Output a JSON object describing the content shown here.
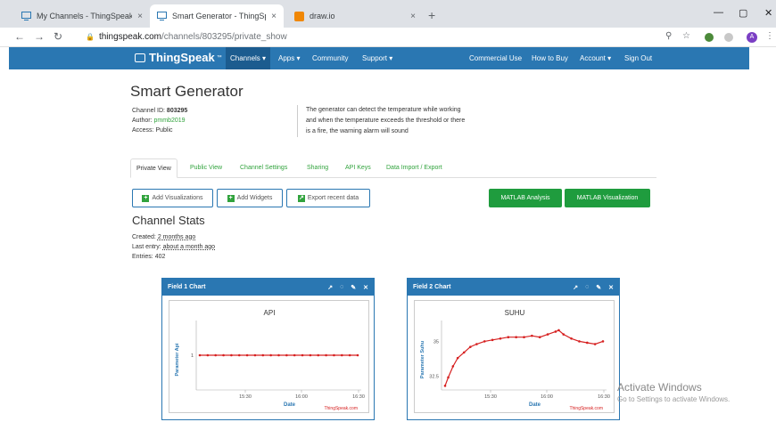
{
  "browser": {
    "tabs": [
      {
        "title": "My Channels - ThingSpeak IoT",
        "close": "×"
      },
      {
        "title": "Smart Generator - ThingSpeak Io",
        "close": "×"
      },
      {
        "title": "draw.io",
        "close": "×"
      }
    ],
    "new_tab": "+",
    "window_controls": {
      "minimize": "—",
      "maximize": "▢",
      "close": "✕"
    },
    "url_domain": "thingspeak.com",
    "url_path": "/channels/803295/private_show",
    "profile_initial": "A"
  },
  "topnav": {
    "logo": "ThingSpeak",
    "logo_tm": "™",
    "left_items": [
      "Channels ▾",
      "Apps ▾",
      "Community",
      "Support ▾"
    ],
    "right_items": [
      "Commercial Use",
      "How to Buy",
      "Account ▾",
      "Sign Out"
    ]
  },
  "channel": {
    "title": "Smart Generator",
    "id_label": "Channel ID:",
    "id_value": "803295",
    "author_label": "Author:",
    "author_value": "pmmb2019",
    "access_label": "Access:",
    "access_value": "Public",
    "description": "The generator can detect the temperature while working and when the temperature exceeds the threshold or there is a fire, the warning alarm will sound"
  },
  "page_tabs": [
    "Private View",
    "Public View",
    "Channel Settings",
    "Sharing",
    "API Keys",
    "Data Import / Export"
  ],
  "buttons": {
    "add_visualizations": "Add Visualizations",
    "add_widgets": "Add Widgets",
    "export_recent": "Export recent data",
    "matlab_analysis": "MATLAB Analysis",
    "matlab_visualization": "MATLAB Visualization"
  },
  "stats": {
    "heading": "Channel Stats",
    "created_label": "Created:",
    "created_value": "2 months ago",
    "last_entry_label": "Last entry:",
    "last_entry_value": "about a month ago",
    "entries_label": "Entries:",
    "entries_value": "402"
  },
  "field1": {
    "header": "Field 1 Chart",
    "credit": "ThingSpeak.com"
  },
  "field2": {
    "header": "Field 2 Chart",
    "credit": "ThingSpeak.com"
  },
  "chart_data": [
    {
      "type": "line",
      "title": "API",
      "xlabel": "Date",
      "ylabel": "Parameter Api",
      "xticks": [
        "15:30",
        "16:00",
        "16:30"
      ],
      "yticks": [
        "1"
      ],
      "ylim": [
        0,
        2
      ],
      "series": [
        {
          "x": [
            0.0,
            0.05,
            0.1,
            0.15,
            0.2,
            0.25,
            0.3,
            0.35,
            0.4,
            0.45,
            0.5,
            0.55,
            0.6,
            0.65,
            0.7,
            0.75,
            0.8,
            0.85,
            0.9,
            0.95,
            1.0
          ],
          "values": [
            1,
            1,
            1,
            1,
            1,
            1,
            1,
            1,
            1,
            1,
            1,
            1,
            1,
            1,
            1,
            1,
            1,
            1,
            1,
            1,
            1
          ]
        }
      ],
      "color": "#d62020"
    },
    {
      "type": "line",
      "title": "SUHU",
      "xlabel": "Date",
      "ylabel": "Parameter Suhu",
      "xticks": [
        "15:30",
        "16:00",
        "16:30"
      ],
      "yticks": [
        "35",
        "32.5"
      ],
      "ylim": [
        31.5,
        36.5
      ],
      "series": [
        {
          "x": [
            0.0,
            0.02,
            0.05,
            0.08,
            0.12,
            0.16,
            0.2,
            0.25,
            0.3,
            0.35,
            0.4,
            0.45,
            0.5,
            0.55,
            0.6,
            0.65,
            0.7,
            0.72,
            0.75,
            0.8,
            0.85,
            0.9,
            0.95,
            1.0
          ],
          "values": [
            31.8,
            32.4,
            33.2,
            33.8,
            34.2,
            34.6,
            34.8,
            35.0,
            35.1,
            35.2,
            35.3,
            35.3,
            35.3,
            35.4,
            35.3,
            35.5,
            35.7,
            35.8,
            35.5,
            35.2,
            35.0,
            34.9,
            34.8,
            35.0
          ]
        }
      ],
      "color": "#d62020"
    }
  ],
  "watermark": {
    "line1": "Activate Windows",
    "line2": "Go to Settings to activate Windows."
  }
}
